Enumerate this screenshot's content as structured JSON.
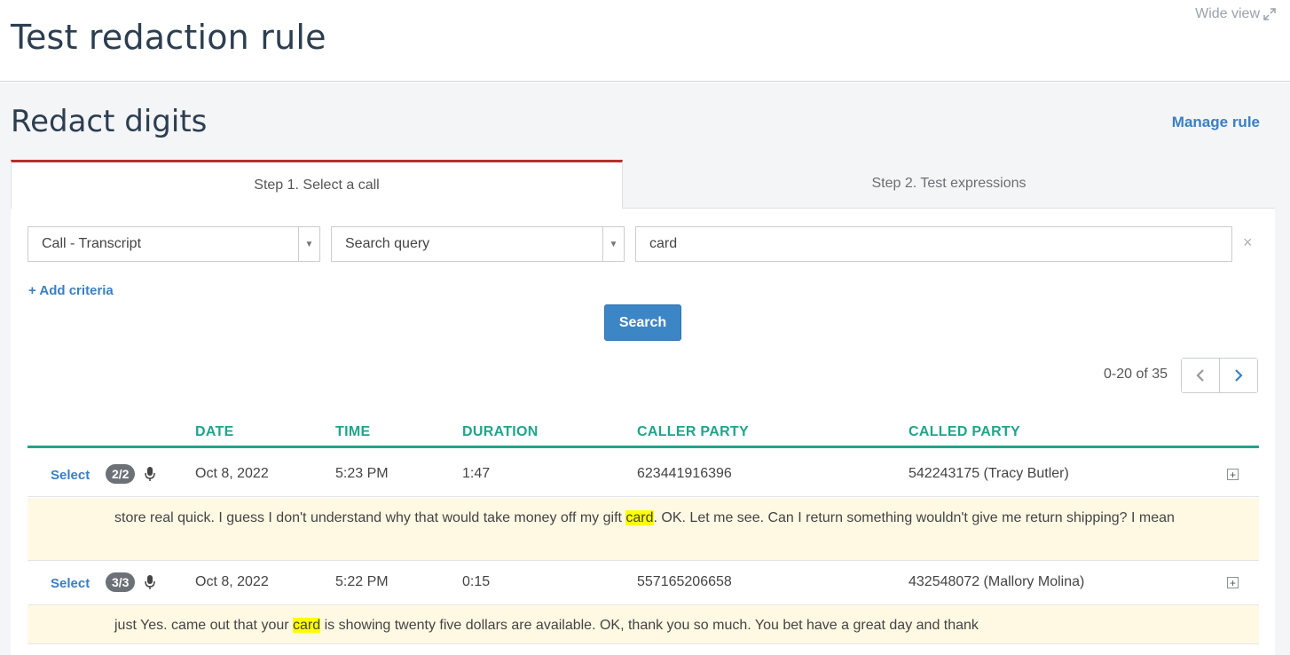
{
  "header": {
    "title": "Test redaction rule",
    "wide_view_label": "Wide view"
  },
  "section": {
    "title": "Redact digits",
    "manage_label": "Manage rule"
  },
  "tabs": [
    {
      "label": "Step 1. Select a call",
      "active": true
    },
    {
      "label": "Step 2. Test expressions",
      "active": false
    }
  ],
  "criteria": {
    "field_select": "Call - Transcript",
    "operator_select": "Search query",
    "query_value": "card",
    "clear_symbol": "×",
    "add_criteria_label": "Add criteria",
    "add_symbol": "+"
  },
  "search_button": "Search",
  "pagination": {
    "text": "0-20 of 35"
  },
  "table": {
    "columns": [
      "DATE",
      "TIME",
      "DURATION",
      "CALLER PARTY",
      "CALLED PARTY"
    ],
    "select_label": "Select",
    "expand_symbol": "+",
    "rows": [
      {
        "badge": "2/2",
        "date": "Oct 8, 2022",
        "time": "5:23 PM",
        "duration": "1:47",
        "caller": "623441916396",
        "called": "542243175 (Tracy Butler)",
        "snippet_before": "store real quick. I guess I don't understand why that would take money off my gift ",
        "snippet_match": "card",
        "snippet_after": ". OK. Let me see. Can I return something wouldn't give me return shipping? I mean"
      },
      {
        "badge": "3/3",
        "date": "Oct 8, 2022",
        "time": "5:22 PM",
        "duration": "0:15",
        "caller": "557165206658",
        "called": "432548072 (Mallory Molina)",
        "snippet_before": "just Yes. came out that your ",
        "snippet_match": "card",
        "snippet_after": " is showing twenty five dollars are available. OK, thank you so much. You bet have a great day and thank"
      }
    ]
  },
  "colors": {
    "accent_teal": "#1fa58b",
    "link_blue": "#3a7fc4",
    "active_tab_border": "#b4312c",
    "highlight": "#ffff00",
    "snippet_bg": "#fff9e3"
  }
}
